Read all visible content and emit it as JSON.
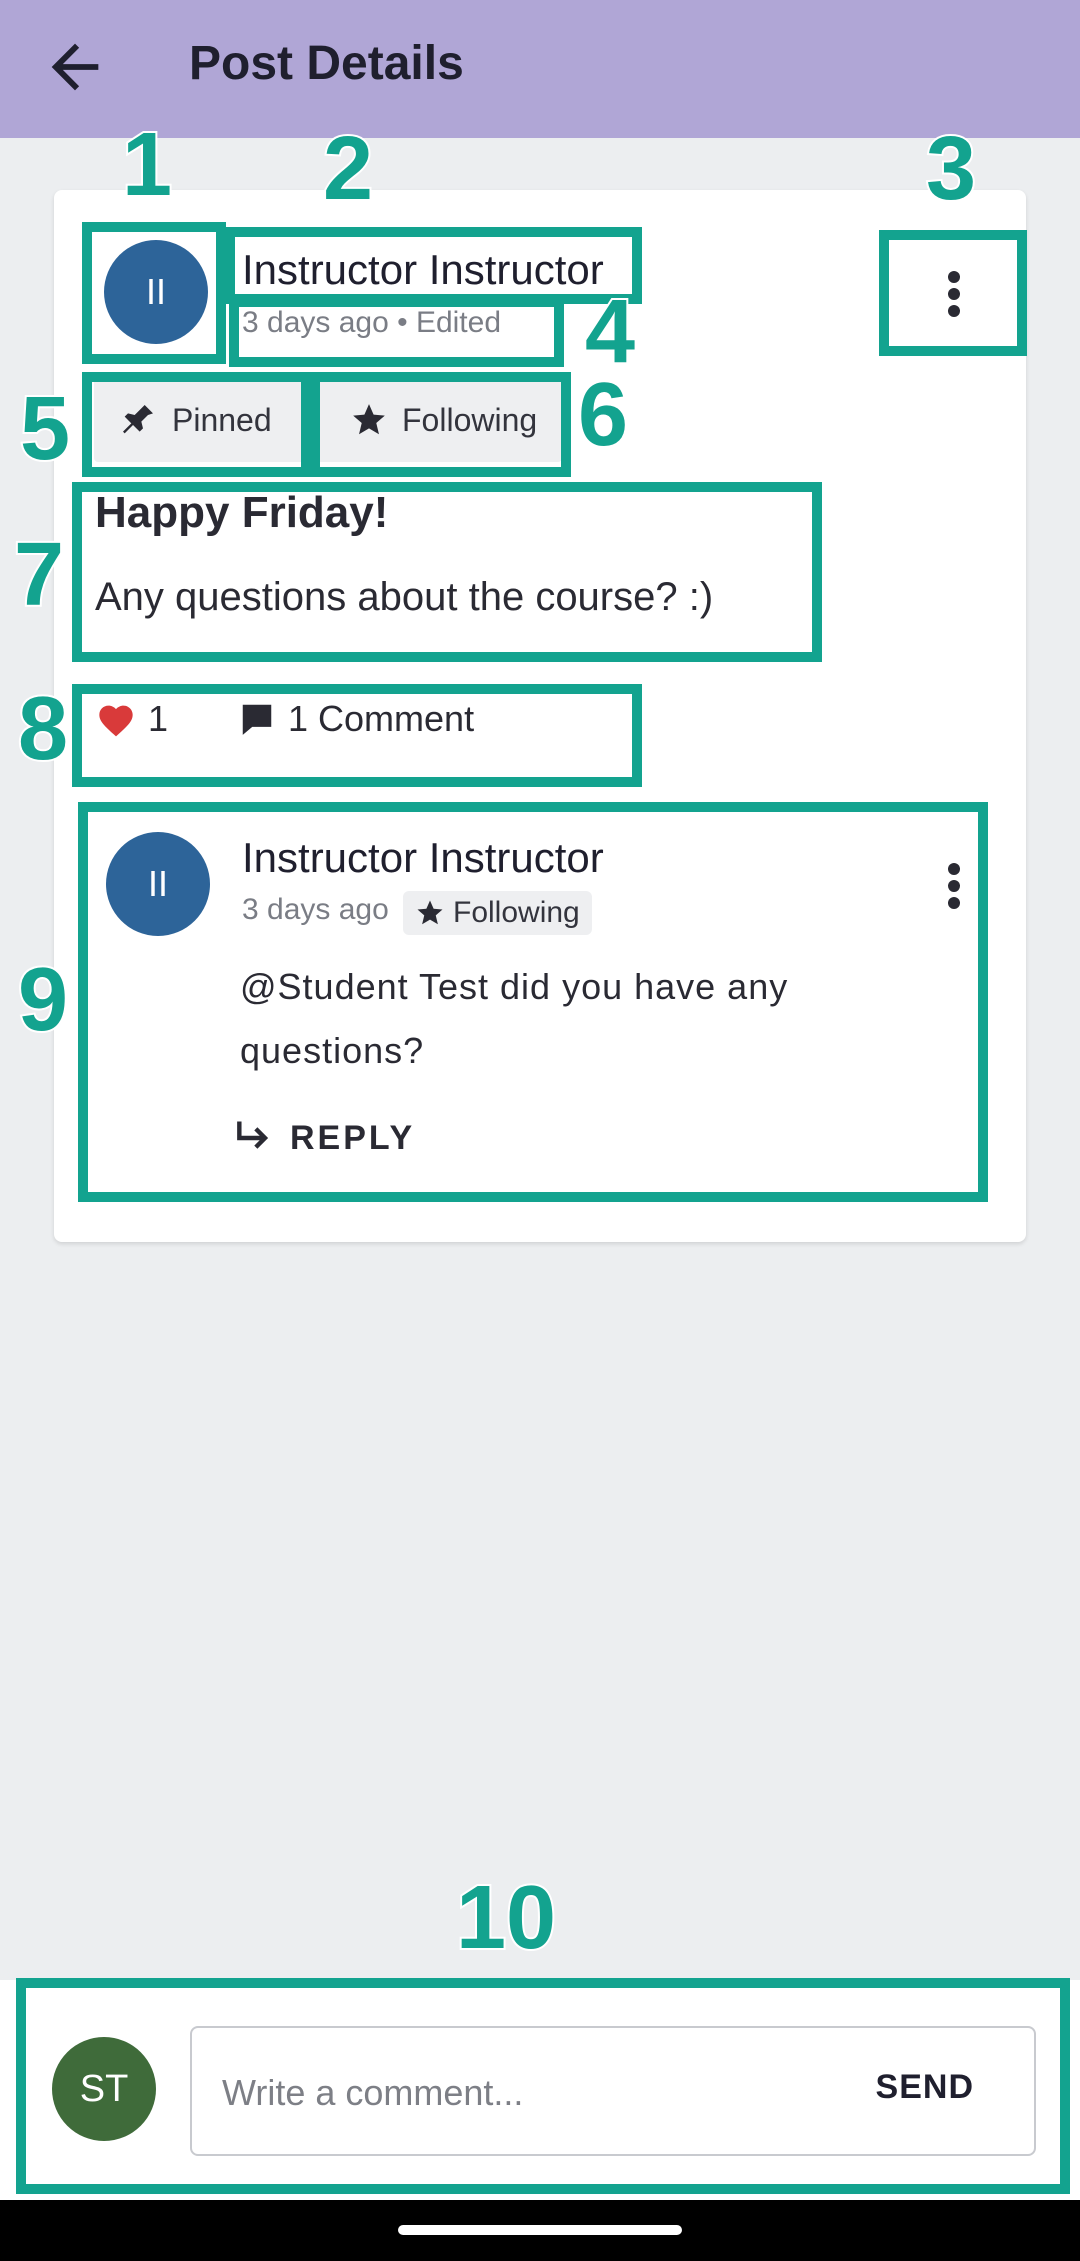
{
  "app_bar": {
    "title": "Post Details",
    "back_icon": "arrow-left-icon",
    "background_color": "#b0a6d6"
  },
  "post": {
    "author_initials": "II",
    "author_name": "Instructor Instructor",
    "meta": "3 days ago • Edited",
    "chips": {
      "pinned": "Pinned",
      "following": "Following"
    },
    "title": "Happy Friday!",
    "body": "Any questions about the course? :)",
    "likes": "1",
    "comments": "1 Comment"
  },
  "comment": {
    "author_initials": "II",
    "author_name": "Instructor Instructor",
    "time": "3 days ago",
    "badge": "Following",
    "text": "@Student Test did you have any questions?",
    "reply_label": "REPLY"
  },
  "composer": {
    "user_initials": "ST",
    "placeholder": "Write a comment...",
    "send_label": "SEND"
  },
  "annotations": [
    "1",
    "2",
    "3",
    "4",
    "5",
    "6",
    "7",
    "8",
    "9",
    "10"
  ],
  "colors": {
    "annotation": "#13a38f",
    "avatar_instructor": "#2d6499",
    "avatar_student": "#3f6b3a",
    "heart": "#d93a3a"
  }
}
